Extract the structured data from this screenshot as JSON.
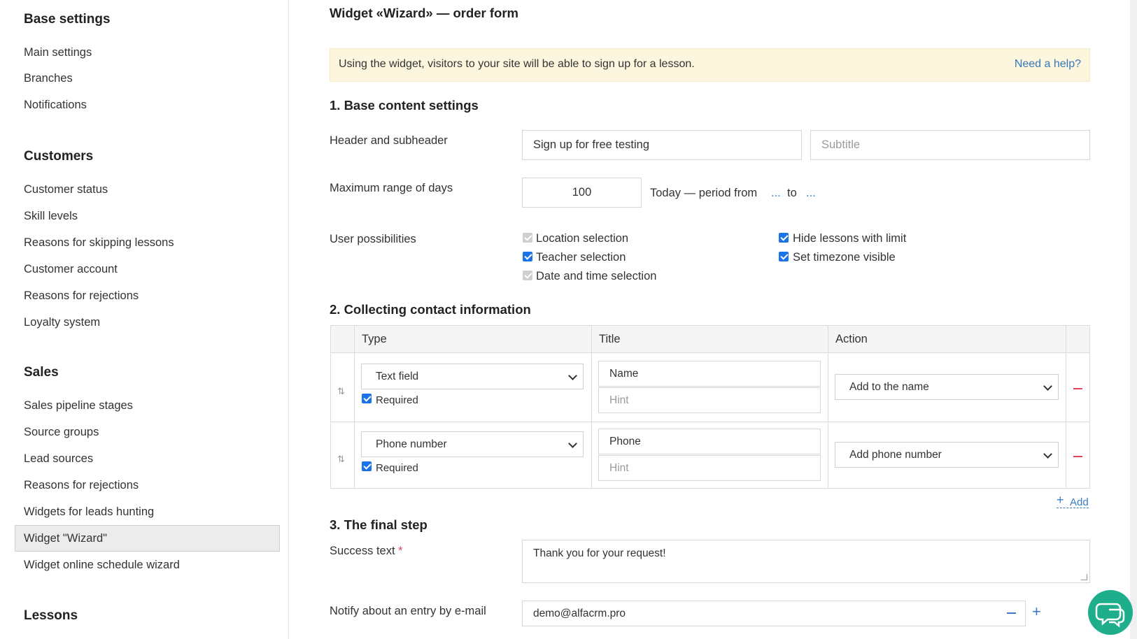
{
  "sidebar": {
    "sections": [
      {
        "heading": "Base settings",
        "items": [
          "Main settings",
          "Branches",
          "Notifications"
        ]
      },
      {
        "heading": "Customers",
        "items": [
          "Customer status",
          "Skill levels",
          "Reasons for skipping lessons",
          "Customer account",
          "Reasons for rejections",
          "Loyalty system"
        ]
      },
      {
        "heading": "Sales",
        "items": [
          "Sales pipeline stages",
          "Source groups",
          "Lead sources",
          "Reasons for rejections",
          "Widgets for leads hunting",
          "Widget \"Wizard\"",
          "Widget online schedule wizard"
        ]
      },
      {
        "heading": "Lessons",
        "items": []
      }
    ],
    "active_item": "Widget \"Wizard\""
  },
  "page": {
    "title": "Widget «Wizard» — order form",
    "notice": {
      "text": "Using the widget, visitors to your site will be able to sign up for a lesson.",
      "help_link": "Need a help?"
    }
  },
  "base_content": {
    "section_title": "1. Base content settings",
    "header_label": "Header and subheader",
    "header_value": "Sign up for free testing",
    "subtitle_placeholder": "Subtitle",
    "max_days_label": "Maximum range of days",
    "max_days_value": "100",
    "period_text": "Today — period from",
    "period_from": "...",
    "period_to_label": "to",
    "period_to": "...",
    "user_possibilities_label": "User possibilities",
    "options": [
      {
        "label": "Location selection",
        "checked": true,
        "disabled": true
      },
      {
        "label": "Teacher selection",
        "checked": true,
        "disabled": false
      },
      {
        "label": "Date and time selection",
        "checked": true,
        "disabled": true
      },
      {
        "label": "Hide lessons with limit",
        "checked": true,
        "disabled": false
      },
      {
        "label": "Set timezone visible",
        "checked": true,
        "disabled": false
      }
    ]
  },
  "contact_info": {
    "section_title": "2. Collecting contact information",
    "columns": [
      "Type",
      "Title",
      "Action"
    ],
    "rows": [
      {
        "type": "Text field",
        "required_label": "Required",
        "required": true,
        "title": "Name",
        "hint_placeholder": "Hint",
        "action": "Add to the name"
      },
      {
        "type": "Phone number",
        "required_label": "Required",
        "required": true,
        "title": "Phone",
        "hint_placeholder": "Hint",
        "action": "Add phone number"
      }
    ],
    "add_label": "Add"
  },
  "final_step": {
    "section_title": "3. The final step",
    "success_label": "Success text",
    "required_mark": "*",
    "success_text": "Thank you for your request!",
    "notify_label": "Notify about an entry by e-mail",
    "notify_email": "demo@alfacrm.pro"
  },
  "colors": {
    "accent": "#1a73e8",
    "link": "#3677b8",
    "danger": "#e0455c",
    "chat": "#1fae8c",
    "notice_bg": "#fdf6df"
  }
}
